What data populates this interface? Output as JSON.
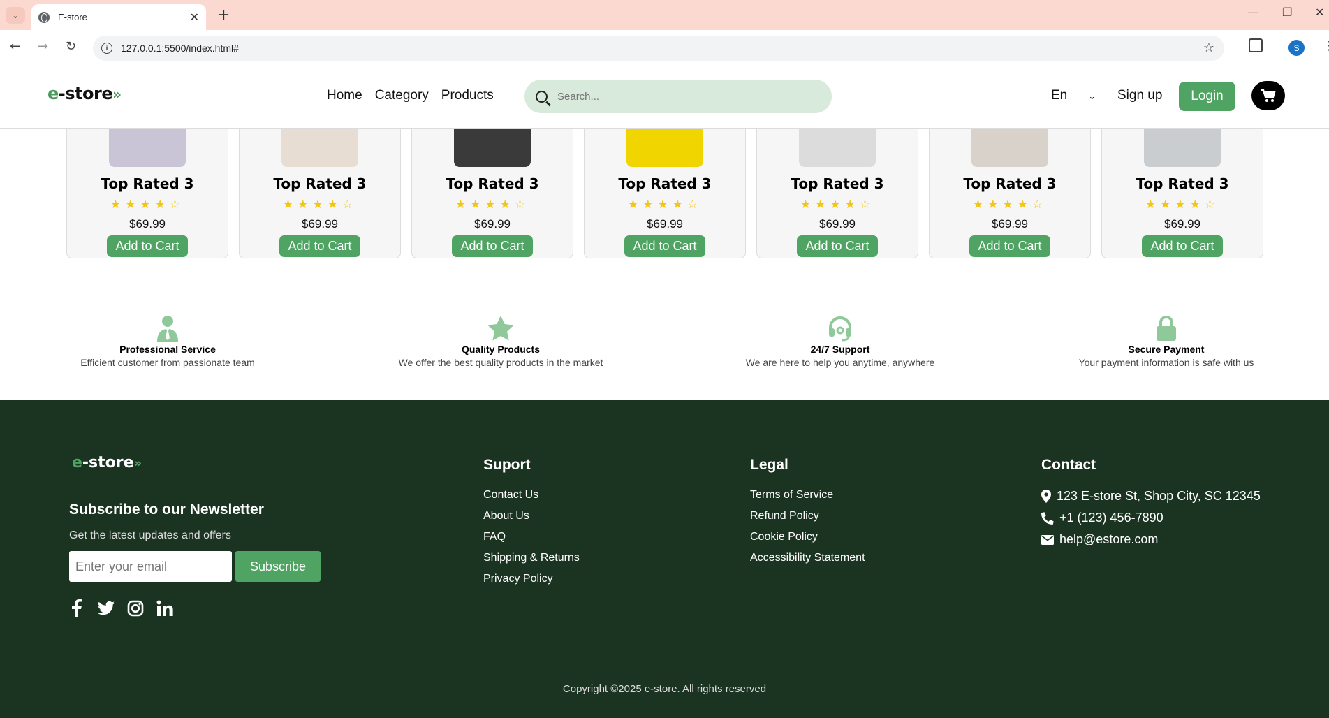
{
  "browser": {
    "tab_title": "E-store",
    "url": "127.0.0.1:5500/index.html#",
    "profile_initial": "S"
  },
  "header": {
    "logo_prefix": "e",
    "logo_text": "-store",
    "logo_suffix": "»",
    "nav": [
      "Home",
      "Category",
      "Products"
    ],
    "search_placeholder": "Search...",
    "language": "En",
    "signup": "Sign up",
    "login": "Login"
  },
  "products": [
    {
      "name": "Top Rated 3",
      "rating": 4,
      "price": "$69.99",
      "button": "Add to Cart",
      "thumb_color": "#c9c4d6"
    },
    {
      "name": "Top Rated 3",
      "rating": 4,
      "price": "$69.99",
      "button": "Add to Cart",
      "thumb_color": "#e8ddd3"
    },
    {
      "name": "Top Rated 3",
      "rating": 4,
      "price": "$69.99",
      "button": "Add to Cart",
      "thumb_color": "#3a3a3a"
    },
    {
      "name": "Top Rated 3",
      "rating": 4,
      "price": "$69.99",
      "button": "Add to Cart",
      "thumb_color": "#f0d500"
    },
    {
      "name": "Top Rated 3",
      "rating": 4,
      "price": "$69.99",
      "button": "Add to Cart",
      "thumb_color": "#dcdcdc"
    },
    {
      "name": "Top Rated 3",
      "rating": 4,
      "price": "$69.99",
      "button": "Add to Cart",
      "thumb_color": "#d8d2cb"
    },
    {
      "name": "Top Rated 3",
      "rating": 4,
      "price": "$69.99",
      "button": "Add to Cart",
      "thumb_color": "#c9cdd0"
    }
  ],
  "features": [
    {
      "title": "Professional Service",
      "desc": "Efficient customer from passionate team",
      "icon": "user-tie-icon"
    },
    {
      "title": "Quality Products",
      "desc": "We offer the best quality products in the market",
      "icon": "star-icon"
    },
    {
      "title": "24/7 Support",
      "desc": "We are here to help you anytime, anywhere",
      "icon": "headset-icon"
    },
    {
      "title": "Secure Payment",
      "desc": "Your payment information is safe with us",
      "icon": "lock-icon"
    }
  ],
  "footer": {
    "logo_prefix": "e",
    "logo_text": "-store",
    "logo_suffix": "»",
    "newsletter_title": "Subscribe to our Newsletter",
    "newsletter_sub": "Get the latest updates and offers",
    "email_placeholder": "Enter your email",
    "subscribe": "Subscribe",
    "social": [
      "facebook-icon",
      "twitter-icon",
      "instagram-icon",
      "linkedin-icon"
    ],
    "support": {
      "heading": "Suport",
      "links": [
        "Contact Us",
        "About Us",
        "FAQ",
        "Shipping & Returns",
        "Privacy Policy"
      ]
    },
    "legal": {
      "heading": "Legal",
      "links": [
        "Terms of Service",
        "Refund Policy",
        "Cookie Policy",
        "Accessibility Statement"
      ]
    },
    "contact": {
      "heading": "Contact",
      "address": "123 E-store St, Shop City, SC 12345",
      "phone": "+1 (123) 456-7890",
      "email": "help@estore.com"
    },
    "copyright": "Copyright ©2025 e-store. All rights reserved"
  },
  "colors": {
    "accent": "#4fa463",
    "footer_bg": "#1b3321",
    "star": "#f3c614",
    "feature_icon": "#8fc99a"
  }
}
